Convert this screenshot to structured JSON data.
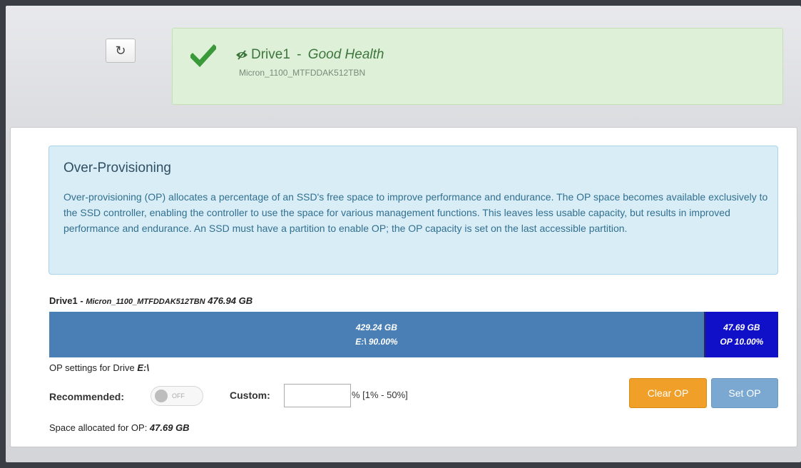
{
  "header": {
    "refresh_icon": "refresh-icon",
    "drive_name": "Drive1",
    "separator": " - ",
    "health_status": "Good Health",
    "model": "Micron_1100_MTFDDAK512TBN",
    "accent_color": "#3c763d"
  },
  "info": {
    "title": "Over-Provisioning",
    "text": "Over-provisioning (OP) allocates a percentage of an SSD's free space to improve performance and endurance. The OP space becomes available exclusively to the SSD controller, enabling the controller to use the space for various management functions. This leaves less usable capacity, but results in improved performance and endurance. An SSD must have a partition to enable OP; the OP capacity is set on the last accessible partition."
  },
  "drive": {
    "name": "Drive1",
    "separator": " - ",
    "model": "Micron_1100_MTFDDAK512TBN",
    "capacity": "476.94 GB"
  },
  "bar": {
    "segments": [
      {
        "size": "429.24 GB",
        "label": "E:\\ 90.00%",
        "fraction": 0.9,
        "color": "#4a7fb5"
      },
      {
        "size": "47.69 GB",
        "label": "OP 10.00%",
        "fraction": 0.1,
        "color": "#1010c8"
      }
    ]
  },
  "settings": {
    "op_settings_prefix": "OP settings for Drive ",
    "drive_letter": "E:\\",
    "recommended_label": "Recommended:",
    "toggle_state": "OFF",
    "custom_label": "Custom:",
    "custom_value": "",
    "range_text": "% [1% - 50%]",
    "clear_label": "Clear OP",
    "set_label": "Set OP",
    "space_prefix": "Space allocated for OP: ",
    "space_value": "47.69 GB"
  }
}
